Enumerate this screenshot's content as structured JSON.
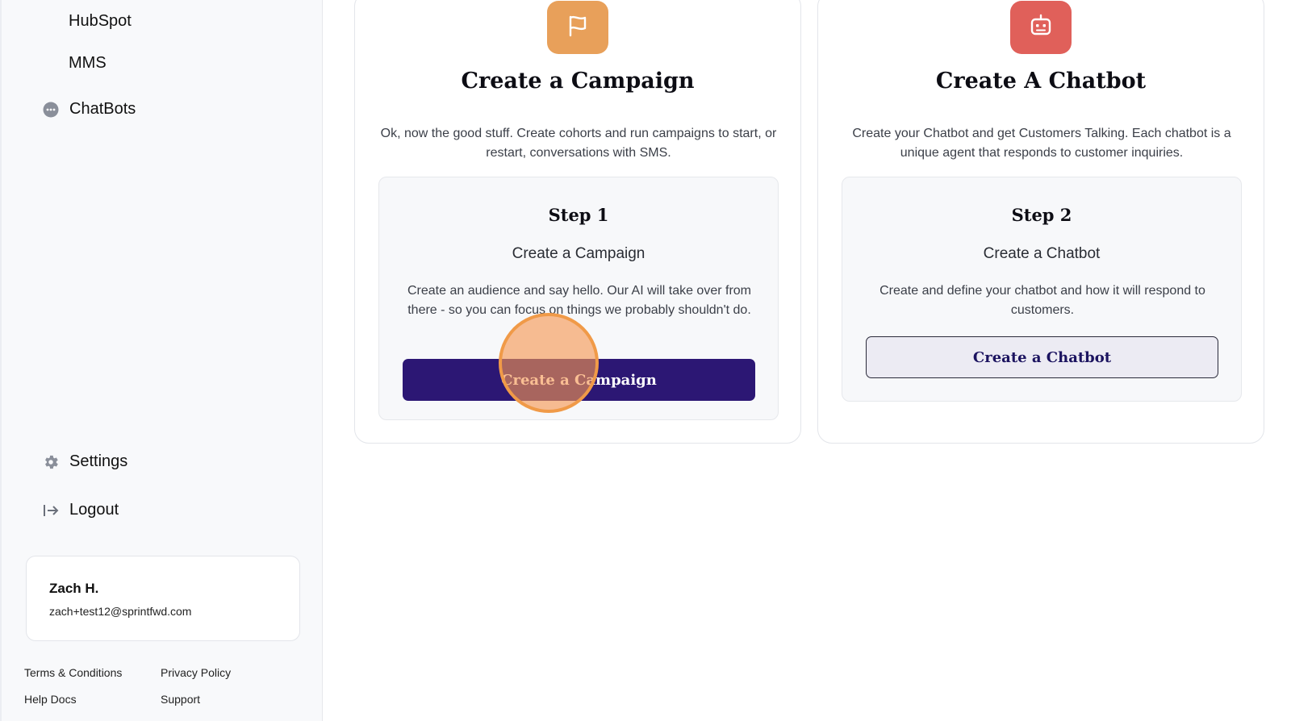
{
  "sidebar": {
    "nav": {
      "hubspot": "HubSpot",
      "mms": "MMS",
      "chatbots": "ChatBots",
      "settings": "Settings",
      "logout": "Logout"
    },
    "user": {
      "name": "Zach H.",
      "email": "zach+test12@sprintfwd.com"
    },
    "footer": {
      "terms": "Terms & Conditions",
      "privacy": "Privacy Policy",
      "help": "Help Docs",
      "support": "Support"
    }
  },
  "cards": {
    "campaign": {
      "icon": "flag-icon",
      "title": "Create a Campaign",
      "description": "Ok, now the good stuff. Create cohorts and run campaigns to start, or restart, conversations with SMS.",
      "step_title": "Step 1",
      "step_subtitle": "Create a Campaign",
      "step_text": "Create an audience and say hello. Our AI will take over from there - so you can focus on things we probably shouldn't do.",
      "button_label": "Create a Campaign"
    },
    "chatbot": {
      "icon": "robot-icon",
      "title": "Create A Chatbot",
      "description": "Create your Chatbot and get Customers Talking. Each chatbot is a unique agent that responds to customer inquiries.",
      "step_title": "Step 2",
      "step_subtitle": "Create a Chatbot",
      "step_text": "Create and define your chatbot and how it will respond to customers.",
      "button_label": "Create a Chatbot"
    }
  },
  "colors": {
    "primary_button": "#2c1774",
    "campaign_badge": "#e8a05a",
    "chatbot_badge": "#e0605a",
    "click_marker": "#f09a48"
  }
}
